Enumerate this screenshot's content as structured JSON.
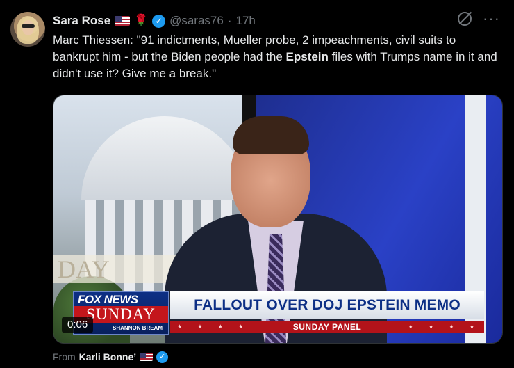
{
  "post": {
    "author_name": "Sara Rose",
    "handle": "@saras76",
    "separator": "·",
    "time": "17h",
    "text_part1": "Marc Thiessen: \"91 indictments, Mueller probe, 2 impeachments, civil suits to bankrupt him - but the Biden people had the ",
    "text_bold": "Epstein",
    "text_part2": " files with Trumps name in it and didn't use it? Give me a break.\""
  },
  "icons": {
    "verified": "verified-badge",
    "flag": "us-flag",
    "rose": "rose-emoji",
    "grok": "grok-icon",
    "more": "more-icon"
  },
  "video": {
    "duration": "0:06",
    "backdrop_text": "DAY",
    "chyron_headline": "FALLOUT OVER DOJ EPSTEIN MEMO",
    "chyron_subline": "SUNDAY PANEL",
    "logo_brand": "FOX NEWS",
    "logo_show": "SUNDAY",
    "logo_host": "SHANNON BREAM",
    "stars": "★ ★ ★ ★"
  },
  "attribution": {
    "prefix": "From",
    "source_name": "Karli Bonne’"
  },
  "colors": {
    "background": "#000000",
    "text": "#e7e9ea",
    "muted": "#71767b",
    "verified_blue": "#1d9bf0"
  }
}
